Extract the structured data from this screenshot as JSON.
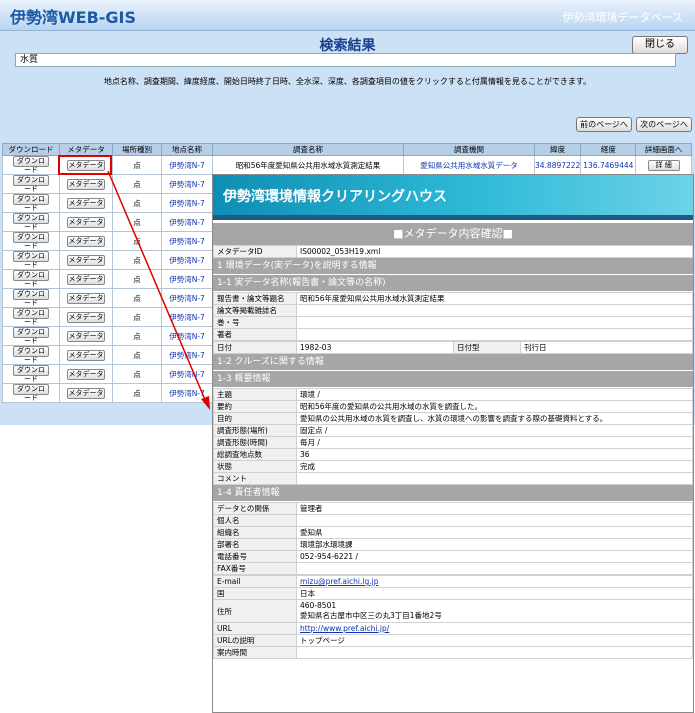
{
  "app": {
    "title": "伊勢湾WEB-GIS",
    "subtitle": "伊勢湾環境データベース"
  },
  "results": {
    "title": "検索結果",
    "close_label": "閉じる",
    "query": "水質",
    "instruction": "地点名称、調査期間、緯度経度、開始日時終了日時、全水深、深度、各調査項目の値をクリックすると付属情報を見ることができます。",
    "prev_label": "前のページへ",
    "next_label": "次のページへ",
    "columns": [
      "ダウンロード",
      "メタデータ",
      "場所種別",
      "地点名称",
      "調査名称",
      "調査機関",
      "緯度",
      "経度",
      "詳細画面へ"
    ],
    "download_label": "ダウンロード",
    "meta_label": "メタデータ",
    "rows": [
      {
        "type": "点",
        "station": "伊勢湾N-7",
        "survey": "昭和56年度愛知県公共用水域水質測定結果",
        "agency": "愛知県公共用水域水質データ",
        "lat": "34.8897222",
        "lon": "136.7469444",
        "detail": "詳 細"
      },
      {
        "type": "点",
        "station": "伊勢湾N-7"
      },
      {
        "type": "点",
        "station": "伊勢湾N-7"
      },
      {
        "type": "点",
        "station": "伊勢湾N-7"
      },
      {
        "type": "点",
        "station": "伊勢湾N-7"
      },
      {
        "type": "点",
        "station": "伊勢湾N-7"
      },
      {
        "type": "点",
        "station": "伊勢湾N-7"
      },
      {
        "type": "点",
        "station": "伊勢湾N-7"
      },
      {
        "type": "点",
        "station": "伊勢湾N-7"
      },
      {
        "type": "点",
        "station": "伊勢湾N-7"
      },
      {
        "type": "点",
        "station": "伊勢湾N-7"
      },
      {
        "type": "点",
        "station": "伊勢湾N-7"
      },
      {
        "type": "点",
        "station": "伊勢湾N-7"
      }
    ]
  },
  "meta": {
    "header": "伊勢湾環境情報クリアリングハウス",
    "confirm": "■メタデータ内容確認■",
    "id_label": "メタデータID",
    "id_value": "IS00002_053H19.xml",
    "s1": "1 環境データ(実データ)を説明する情報",
    "s1_1": "1-1 実データ名称(報告書・論文等の名称)",
    "rows_1_1": [
      {
        "k": "報告書・論文等題名",
        "v": "昭和56年度愛知県公共用水域水質測定結果"
      },
      {
        "k": "論文等掲載雑誌名",
        "v": ""
      },
      {
        "k": "巻・号",
        "v": ""
      },
      {
        "k": "著者",
        "v": ""
      }
    ],
    "date_label": "日付",
    "date_value": "1982-03",
    "date_type_label": "日付型",
    "date_type_value": "刊行日",
    "s1_2": "1-2 クルーズに関する情報",
    "s1_3": "1-3 概要情報",
    "rows_1_3": [
      {
        "k": "主題",
        "v": "環境 /"
      },
      {
        "k": "要約",
        "v": "昭和56年度の愛知県の公共用水域の水質を調査した。"
      },
      {
        "k": "目的",
        "v": "愛知県の公共用水域の水質を調査し、水質の環境への影響を調査する際の基礎資料とする。"
      },
      {
        "k": "調査形態(場所)",
        "v": "固定点 /"
      },
      {
        "k": "調査形態(時間)",
        "v": "毎月 /"
      },
      {
        "k": "総調査地点数",
        "v": "36"
      },
      {
        "k": "状態",
        "v": "完成"
      },
      {
        "k": "コメント",
        "v": ""
      }
    ],
    "s1_4": "1-4 責任者情報",
    "rows_1_4": [
      {
        "k": "データとの関係",
        "v": "管理者"
      },
      {
        "k": "個人名",
        "v": ""
      },
      {
        "k": "組織名",
        "v": "愛知県"
      },
      {
        "k": "部署名",
        "v": "環境部水環境課"
      },
      {
        "k": "電話番号",
        "v": "052-954-6221 /"
      },
      {
        "k": "FAX番号",
        "v": ""
      }
    ],
    "email_label": "E-mail",
    "email_value": "mizu@pref.aichi.lg.jp",
    "country_label": "国",
    "country_value": "日本",
    "address_label": "住所",
    "address_zip": "460-8501",
    "address_value": "愛知県名古屋市中区三の丸3丁目1番地2号",
    "url_label": "URL",
    "url_value": "http://www.pref.aichi.jp/",
    "url_desc_label": "URLの説明",
    "url_desc_value": "トップページ",
    "hours_label": "案内時間"
  },
  "colors": {
    "accent": "#1d5aa6",
    "panel": "#cce1f5",
    "highlight": "#e00000",
    "popup_header": "#2fbad7"
  }
}
